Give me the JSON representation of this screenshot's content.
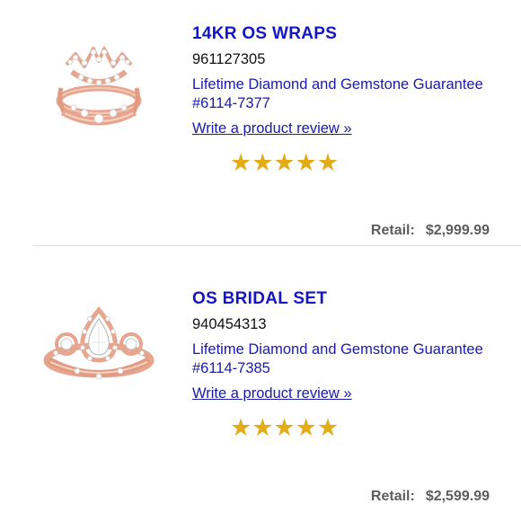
{
  "products": [
    {
      "title": "14KR OS WRAPS",
      "sku": "961127305",
      "guarantee": "Lifetime Diamond and Gemstone Guarantee #6114-7377",
      "review_link": "Write a product review »",
      "rating": 5,
      "stars": "★★★★★",
      "retail_label": "Retail:",
      "price": "$2,999.99",
      "image_icon": "ring-wrap-image"
    },
    {
      "title": "OS BRIDAL SET",
      "sku": "940454313",
      "guarantee": "Lifetime Diamond and Gemstone Guarantee #6114-7385",
      "review_link": "Write a product review »",
      "rating": 5,
      "stars": "★★★★★",
      "retail_label": "Retail:",
      "price": "$2,599.99",
      "image_icon": "bridal-ring-image"
    }
  ],
  "colors": {
    "title": "#1414c8",
    "link": "#1a1aa8",
    "star": "#e2ac17",
    "retail": "#5d5d5d",
    "rose_gold": "#e8a58e"
  }
}
